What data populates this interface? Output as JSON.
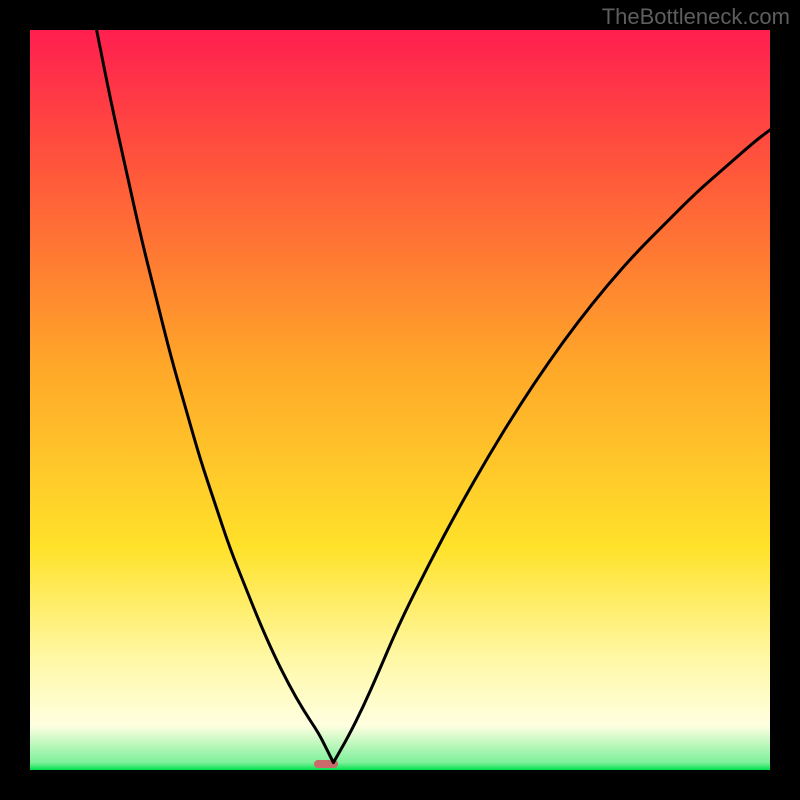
{
  "watermark": "TheBottleneck.com",
  "gradient": {
    "angle_deg": 180,
    "stops": [
      {
        "pct": 0,
        "color": "#ff1f4f"
      },
      {
        "pct": 20,
        "color": "#ff5a3a"
      },
      {
        "pct": 45,
        "color": "#ffa629"
      },
      {
        "pct": 70,
        "color": "#ffe22a"
      },
      {
        "pct": 85,
        "color": "#fff8a6"
      },
      {
        "pct": 94,
        "color": "#ffffe0"
      },
      {
        "pct": 99,
        "color": "#7df09a"
      },
      {
        "pct": 100,
        "color": "#00e04b"
      }
    ]
  },
  "marker": {
    "x_units": 40,
    "y_units": 99.2,
    "w_units": 3.2,
    "h_units": 1.1,
    "color": "#c96b6b"
  },
  "chart_data": {
    "type": "line",
    "title": "",
    "xlabel": "",
    "ylabel": "",
    "xlim": [
      0,
      100
    ],
    "ylim": [
      0,
      100
    ],
    "note": "y-axis is inverted visually (0 at top, 100 at bottom); values below are in data-space where 100 = bottom (green)",
    "series": [
      {
        "name": "left-branch",
        "x": [
          9,
          11,
          13,
          15,
          17,
          19,
          21,
          23,
          25,
          27,
          29,
          31,
          33,
          35,
          37,
          39,
          40,
          41
        ],
        "y": [
          0,
          10,
          19,
          28,
          36,
          44,
          51,
          58,
          64,
          70,
          75,
          80,
          84.5,
          88.5,
          92,
          95,
          97,
          99
        ]
      },
      {
        "name": "right-branch",
        "x": [
          41,
          43,
          45,
          47,
          50,
          54,
          58,
          62,
          66,
          70,
          74,
          78,
          82,
          86,
          90,
          94,
          98,
          100
        ],
        "y": [
          99,
          95.5,
          91.5,
          87,
          80,
          72,
          64.5,
          57.5,
          51,
          45,
          39.5,
          34.5,
          30,
          26,
          22,
          18.5,
          15,
          13.5
        ]
      }
    ],
    "minimum_point": {
      "x": 41,
      "y": 99
    }
  }
}
